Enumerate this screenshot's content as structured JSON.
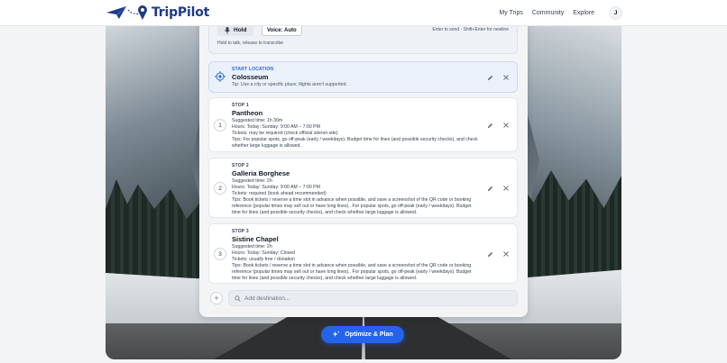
{
  "app": {
    "brand": "TripPilot"
  },
  "nav": {
    "items": [
      "My Trips",
      "Community",
      "Explore"
    ],
    "avatar_initial": "J"
  },
  "voice": {
    "hold_label": "Hold",
    "voice_mode": "Voice: Auto",
    "hold_hint": "Hold to talk, release to transcribe",
    "send_hint": "Enter to send · Shift+Enter for newline"
  },
  "start": {
    "label": "START LOCATION",
    "place": "Colosseum",
    "tip": "Tip: Use a city or specific place; flights aren't supported."
  },
  "stops": [
    {
      "number": "1",
      "label": "STOP 1",
      "place": "Pantheon",
      "lines": [
        "Suggested time: 1h 30m",
        "Hours: Today: Sunday: 9:00 AM – 7:00 PM",
        "Tickets: may be required (check official site/on-site)",
        "Tips: For popular spots, go off-peak (early / weekdays). Budget time for lines (and possible security checks), and check whether large luggage is allowed."
      ]
    },
    {
      "number": "2",
      "label": "STOP 2",
      "place": "Galleria Borghese",
      "lines": [
        "Suggested time: 2h",
        "Hours: Today: Sunday: 9:00 AM – 7:00 PM",
        "Tickets: required (book ahead recommended)",
        "Tips: Book tickets / reserve a time slot in advance when possible, and save a screenshot of the QR code or booking reference (popular times may sell out or have long lines).. For popular spots, go off-peak (early / weekdays). Budget time for lines (and possible security checks), and check whether large luggage is allowed."
      ]
    },
    {
      "number": "3",
      "label": "STOP 3",
      "place": "Sistine Chapel",
      "lines": [
        "Suggested time: 2h",
        "Hours: Today: Sunday: Closed",
        "Tickets: usually free / donation",
        "Tips: Book tickets / reserve a time slot in advance when possible, and save a screenshot of the QR code or booking reference (popular times may sell out or have long lines).. For popular spots, go off-peak (early / weekdays). Budget time for lines (and possible security checks), and check whether large luggage is allowed."
      ]
    }
  ],
  "add": {
    "placeholder": "Add destination..."
  },
  "optimize_label": "Optimize & Plan",
  "colors": {
    "accent": "#2563eb",
    "brand": "#1e3a8a",
    "start_bg": "#eaf1fb"
  }
}
